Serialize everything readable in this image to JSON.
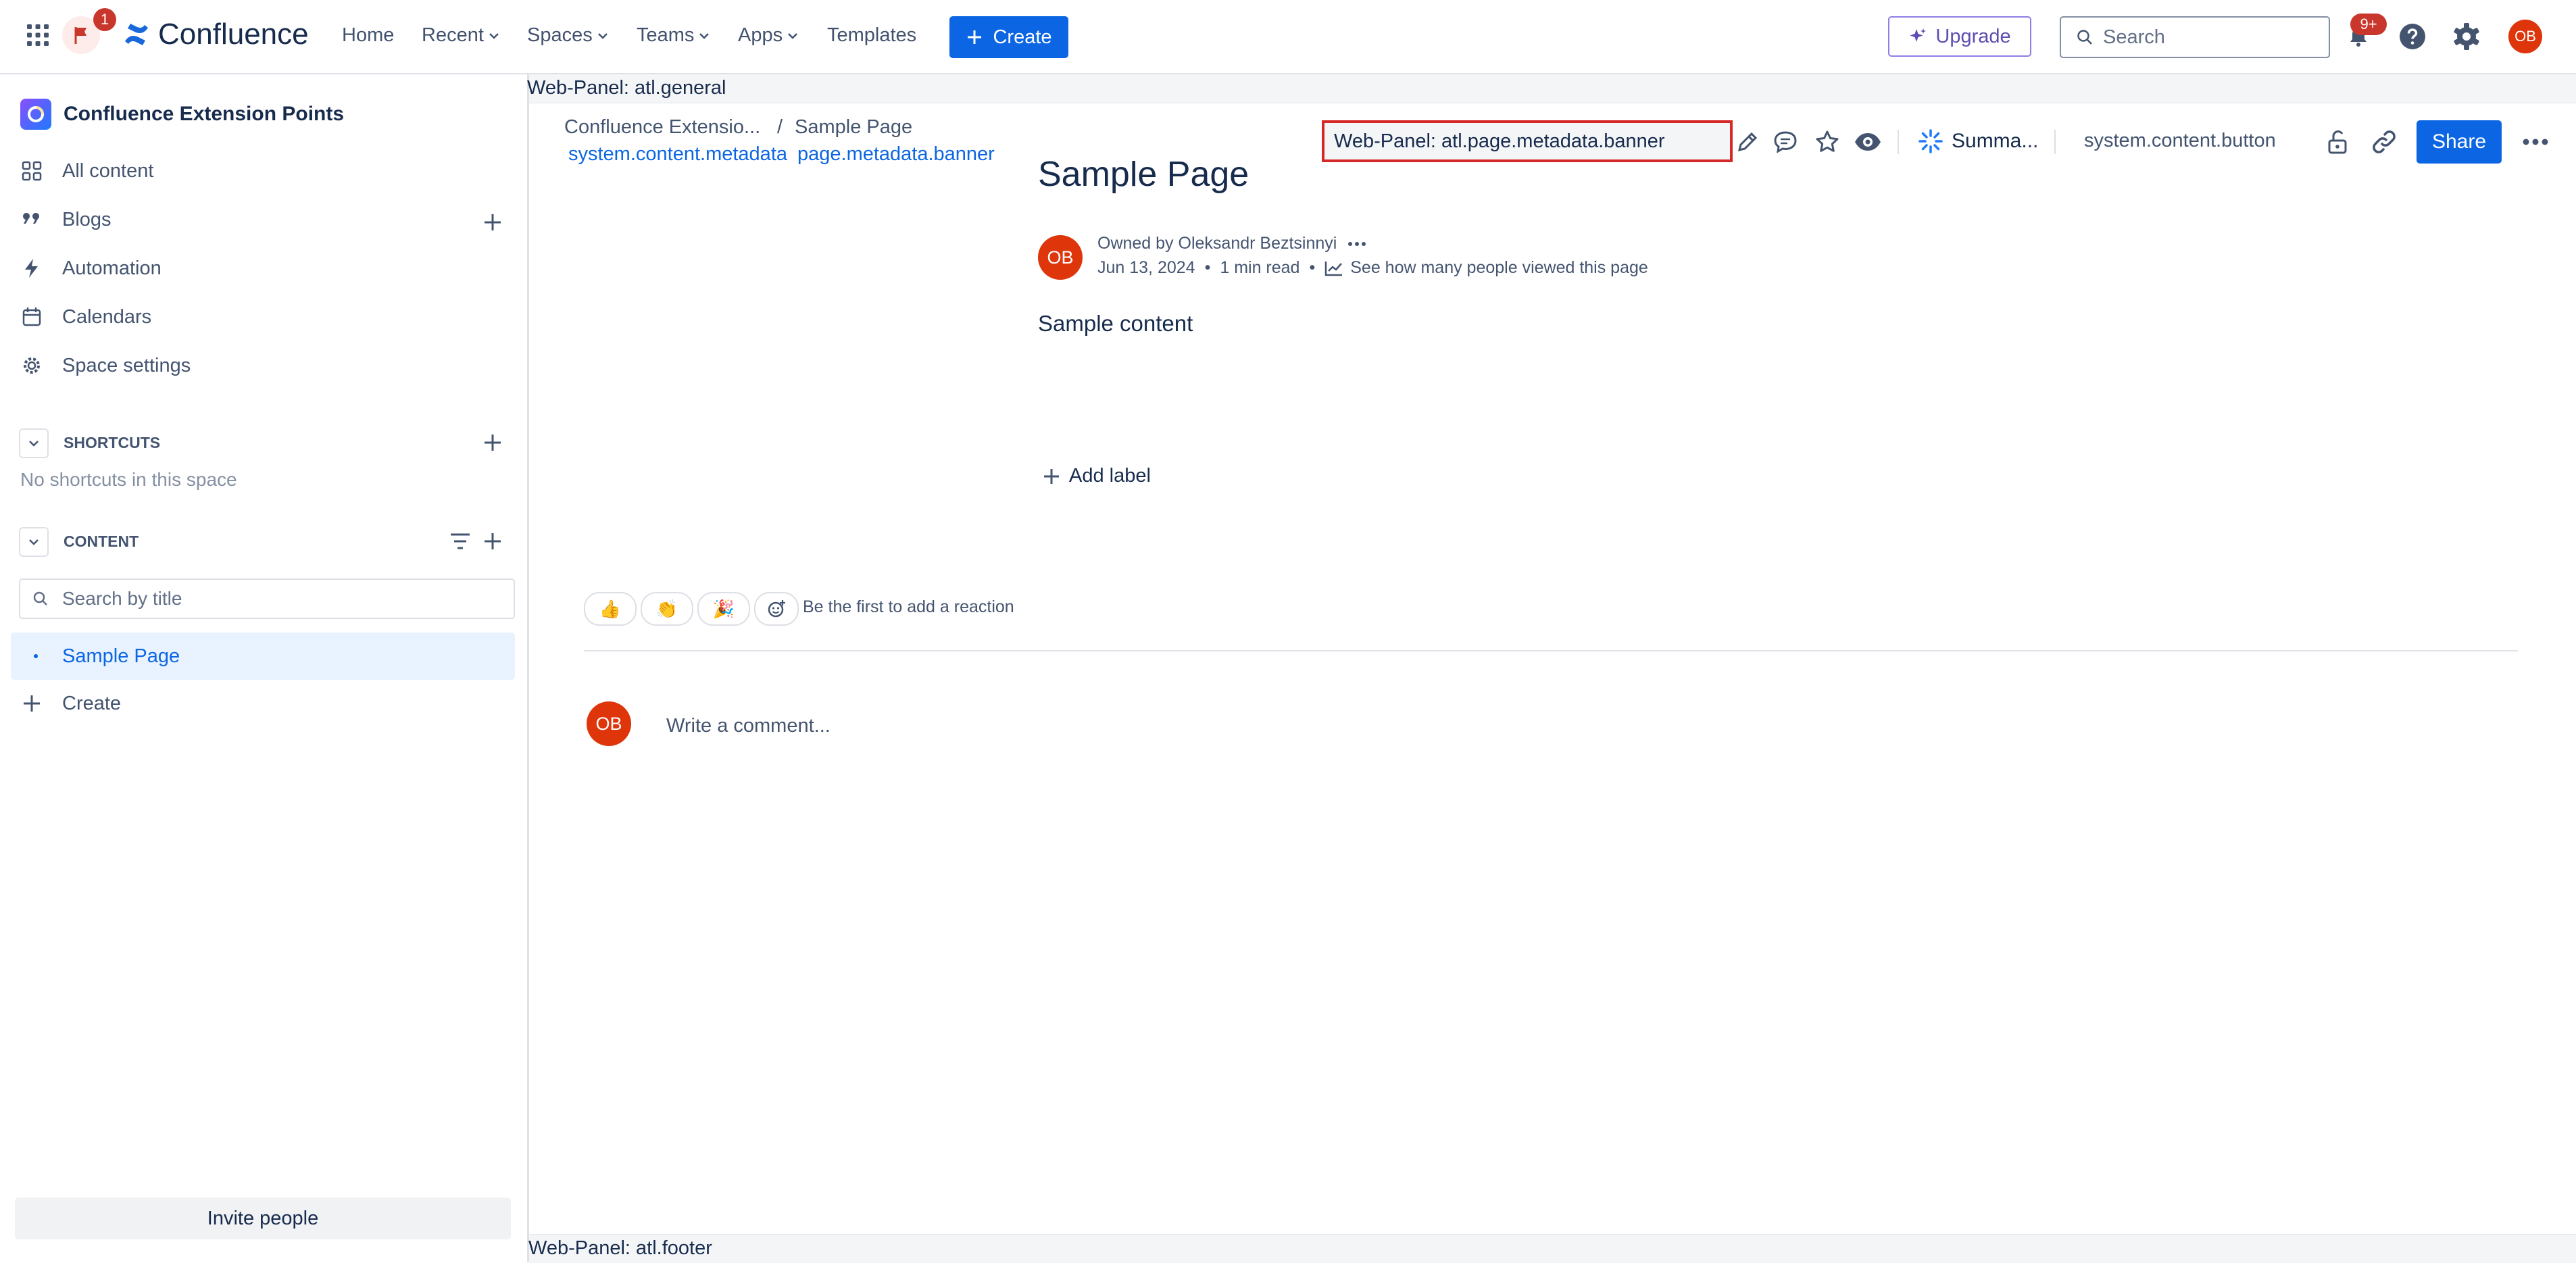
{
  "topnav": {
    "notification_count": "1",
    "brand": "Confluence",
    "links": [
      "Home",
      "Recent",
      "Spaces",
      "Teams",
      "Apps",
      "Templates"
    ],
    "create_label": "Create",
    "upgrade_label": "Upgrade",
    "search_placeholder": "Search",
    "updates_badge": "9+",
    "avatar_initials": "OB"
  },
  "sidebar": {
    "space_name": "Confluence Extension Points",
    "items": [
      "All content",
      "Blogs",
      "Automation",
      "Calendars",
      "Space settings"
    ],
    "shortcuts_heading": "SHORTCUTS",
    "shortcuts_empty": "No shortcuts in this space",
    "content_heading": "CONTENT",
    "search_placeholder": "Search by title",
    "pages": [
      "Sample Page"
    ],
    "create_label": "Create",
    "invite_label": "Invite people"
  },
  "panels": {
    "general": "Web-Panel: atl.general",
    "footer": "Web-Panel: atl.footer",
    "metadata_banner": "Web-Panel: atl.page.metadata.banner"
  },
  "breadcrumb": {
    "space": "Confluence Extensio...",
    "separator": "/",
    "page": "Sample Page"
  },
  "links": {
    "content_metadata": "system.content.metadata",
    "metadata_banner": "page.metadata.banner"
  },
  "toolbar": {
    "summarize_label": "Summa...",
    "content_button": "system.content.button",
    "share_label": "Share"
  },
  "page": {
    "title": "Sample Page",
    "owner_line": "Owned by Oleksandr Beztsinnyi",
    "date": "Jun 13, 2024",
    "read_time": "1 min read",
    "views_link": "See how many people viewed this page",
    "author_initials": "OB",
    "body": "Sample content",
    "add_label": "Add label",
    "reactions_prompt": "Be the first to add a reaction",
    "reactions": [
      "👍",
      "👏",
      "🎉"
    ],
    "comment_placeholder": "Write a comment...",
    "commenter_initials": "OB"
  },
  "colors": {
    "brand_blue": "#0c66e4",
    "avatar_red": "#de350b",
    "highlight_border": "#d62828"
  }
}
